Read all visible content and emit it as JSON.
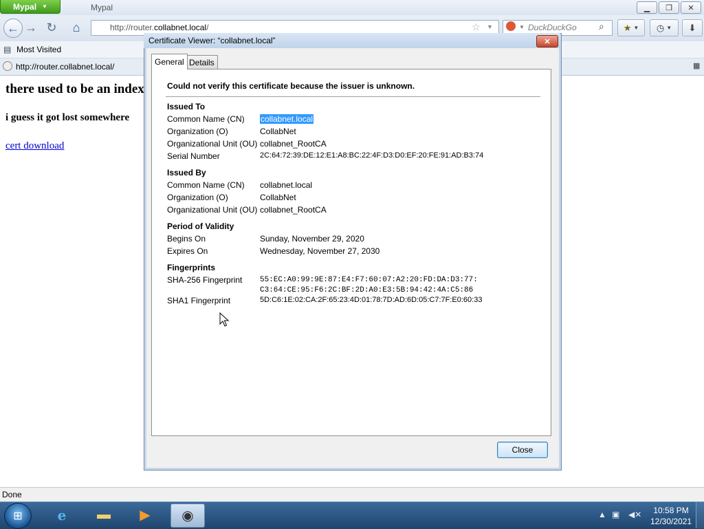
{
  "browser": {
    "app_button": "Mypal",
    "window_title": "Mypal",
    "url_prefix": "http://router.",
    "url_domain": "collabnet.local",
    "url_suffix": "/",
    "search_placeholder": "DuckDuckGo",
    "bookmark_item": "Most Visited",
    "tab_title": "http://router.collabnet.local/",
    "status": "Done"
  },
  "page": {
    "heading": "there used to be an index",
    "subheading": "i guess it got lost somewhere",
    "link": "cert download"
  },
  "dialog": {
    "title": "Certificate Viewer: “collabnet.local”",
    "tabs": [
      "General",
      "Details"
    ],
    "warning": "Could not verify this certificate because the issuer is unknown.",
    "issued_to": {
      "heading": "Issued To",
      "cn_label": "Common Name (CN)",
      "cn": "collabnet.local",
      "o_label": "Organization (O)",
      "o": "CollabNet",
      "ou_label": "Organizational Unit (OU)",
      "ou": "collabnet_RootCA",
      "serial_label": "Serial Number",
      "serial": "2C:64:72:39:DE:12:E1:A8:BC:22:4F:D3:D0:EF:20:FE:91:AD:B3:74"
    },
    "issued_by": {
      "heading": "Issued By",
      "cn_label": "Common Name (CN)",
      "cn": "collabnet.local",
      "o_label": "Organization (O)",
      "o": "CollabNet",
      "ou_label": "Organizational Unit (OU)",
      "ou": "collabnet_RootCA"
    },
    "validity": {
      "heading": "Period of Validity",
      "begins_label": "Begins On",
      "begins": "Sunday, November 29, 2020",
      "expires_label": "Expires On",
      "expires": "Wednesday, November 27, 2030"
    },
    "fingerprints": {
      "heading": "Fingerprints",
      "sha256_label": "SHA-256 Fingerprint",
      "sha256_line1": "55:EC:A0:99:9E:87:E4:F7:60:07:A2:20:FD:DA:D3:77:",
      "sha256_line2": "C3:64:CE:95:F6:2C:BF:2D:A0:E3:5B:94:42:4A:C5:86",
      "sha1_label": "SHA1 Fingerprint",
      "sha1": "5D:C6:1E:02:CA:2F:65:23:4D:01:78:7D:AD:6D:05:C7:7F:E0:60:33"
    },
    "close_label": "Close"
  },
  "taskbar": {
    "time": "10:58 PM",
    "date": "12/30/2021"
  },
  "icons": {
    "back": "back-arrow-icon",
    "forward": "forward-arrow-icon",
    "reload": "reload-icon",
    "home": "home-icon",
    "bookmark_star": "star-icon",
    "search": "magnifier-icon",
    "history": "clock-icon",
    "downloads": "download-arrow-icon"
  }
}
